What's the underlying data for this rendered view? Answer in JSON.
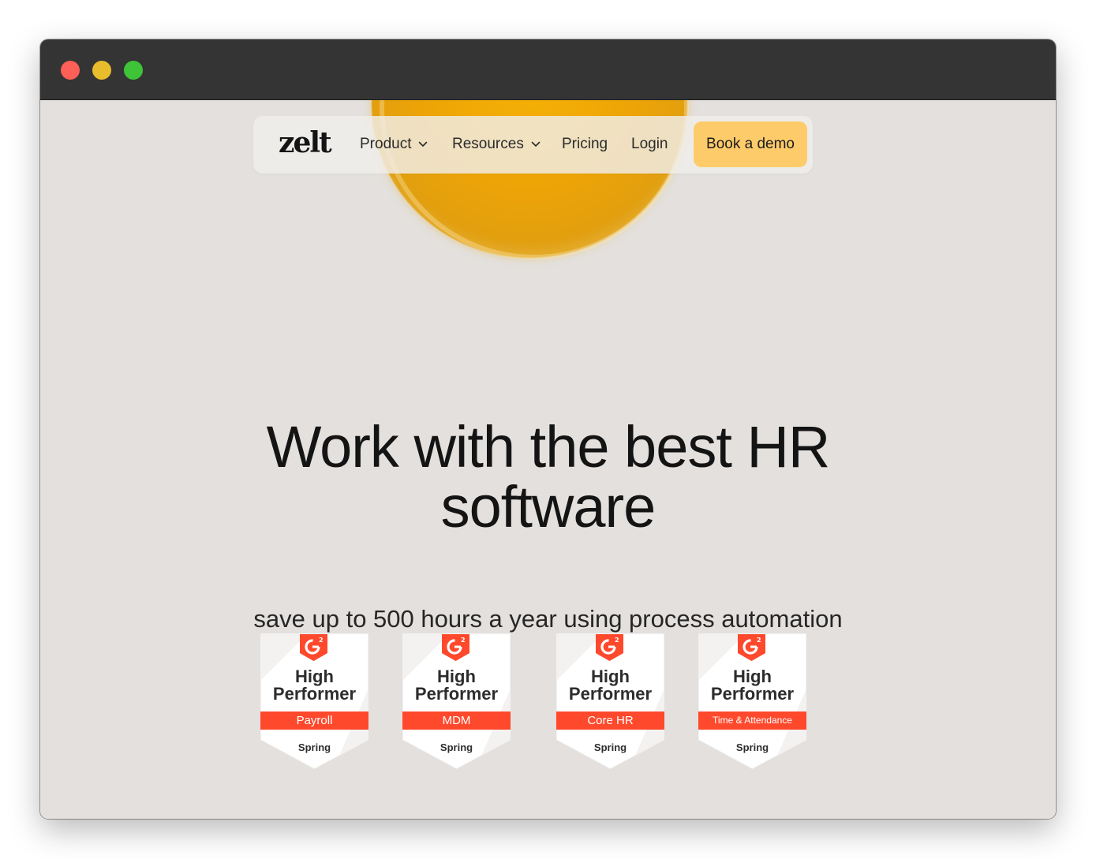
{
  "browser": {
    "controls": [
      "close",
      "minimize",
      "maximize"
    ],
    "colors": {
      "close": "#fe5f57",
      "minimize": "#e7bc2d",
      "maximize": "#3fc338"
    }
  },
  "nav": {
    "logo": "zelt",
    "items": [
      {
        "label": "Product",
        "has_dropdown": true
      },
      {
        "label": "Resources",
        "has_dropdown": true
      },
      {
        "label": "Pricing",
        "has_dropdown": false
      },
      {
        "label": "Login",
        "has_dropdown": false
      }
    ],
    "cta": "Book a demo",
    "cta_color": "#fecb6b"
  },
  "hero": {
    "headline_line1": "Work with the best HR",
    "headline_line2": "software",
    "subheadline": "save up to 500 hours a year using process automation",
    "background_color": "#e3e0dd",
    "accent_color": "#f0a806"
  },
  "badges": [
    {
      "brand": "G2",
      "title_line1": "High",
      "title_line2": "Performer",
      "category": "Payroll",
      "season": "Spring"
    },
    {
      "brand": "G2",
      "title_line1": "High",
      "title_line2": "Performer",
      "category": "MDM",
      "season": "Spring"
    },
    {
      "brand": "G2",
      "title_line1": "High",
      "title_line2": "Performer",
      "category": "Core HR",
      "season": "Spring"
    },
    {
      "brand": "G2",
      "title_line1": "High",
      "title_line2": "Performer",
      "category": "Time & Attendance",
      "season": "Spring"
    }
  ],
  "badge_accent": "#ff492c"
}
